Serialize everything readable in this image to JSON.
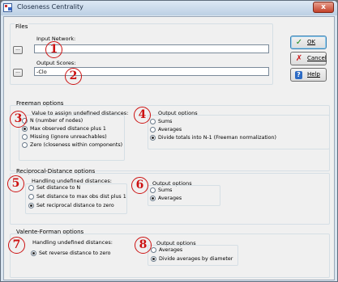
{
  "window": {
    "title": "Closeness Centrality",
    "close_glyph": "x",
    "icon": "ucinet-app-icon"
  },
  "files": {
    "group_label": "Files",
    "input_label": "Input Network:",
    "input_value": "",
    "output_label": "Output Scores:",
    "output_value": "-Clo",
    "browse_label": "..."
  },
  "buttons": {
    "ok": "OK",
    "cancel": "Cancel",
    "help": "Help"
  },
  "freeman": {
    "group_label": "Freeman options",
    "undef_label": "Value to assign undefined distances:",
    "undef_options": [
      "N (number of nodes)",
      "Max observed distance plus 1",
      "Missing (ignore unreachables)",
      "Zero (closeness within components)"
    ],
    "undef_selected": 1,
    "output_label": "Output options",
    "output_options": [
      "Sums",
      "Averages",
      "Divide totals into N-1 (Freeman normalization)"
    ],
    "output_selected": 2
  },
  "reciprocal": {
    "group_label": "Reciprocal-Distance options",
    "undef_label": "Handling undefined distances:",
    "undef_options": [
      "Set distance to N",
      "Set distance to max obs dist plus 1",
      "Set reciprocal distance to zero"
    ],
    "undef_selected": 2,
    "output_label": "Output options",
    "output_options": [
      "Sums",
      "Averages"
    ],
    "output_selected": 1
  },
  "valente": {
    "group_label": "Valente-Forman options",
    "undef_label": "Handling undefined distances:",
    "undef_options": [
      "Set reverse distance to zero"
    ],
    "undef_selected": 0,
    "output_label": "Output options",
    "output_options": [
      "Averages",
      "Divide averages by diameter"
    ],
    "output_selected": 1
  },
  "markers": [
    "1",
    "2",
    "3",
    "4",
    "5",
    "6",
    "7",
    "8"
  ],
  "colors": {
    "marker": "#cc1111",
    "title_bar": "#c8d9ea",
    "dialog_bg": "#f0f0f0"
  }
}
